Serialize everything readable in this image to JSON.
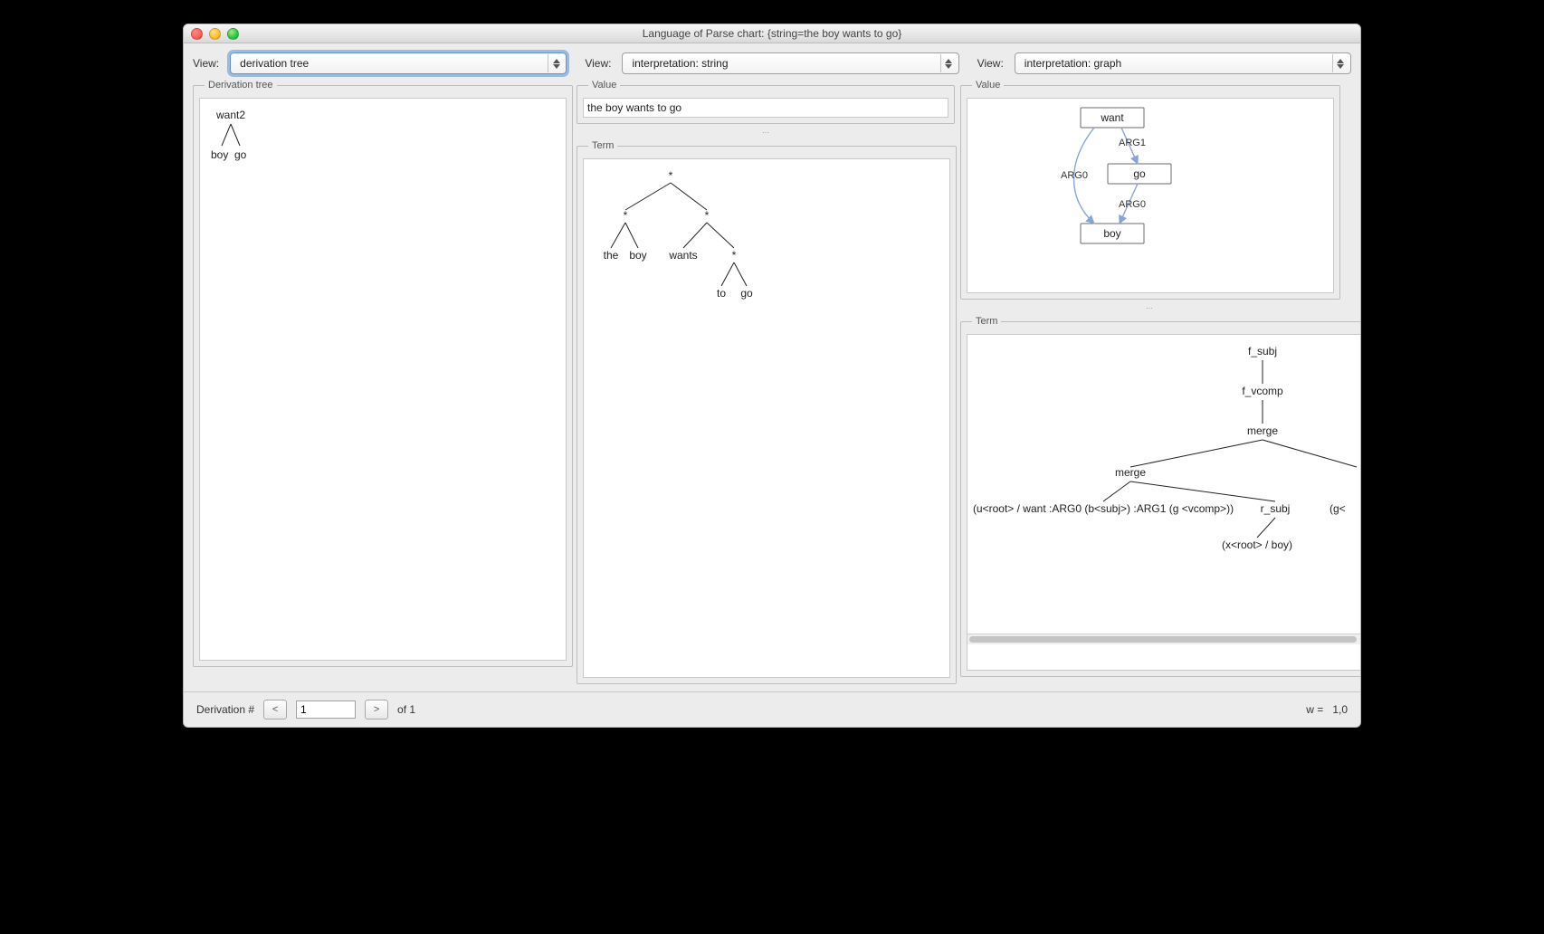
{
  "window": {
    "title": "Language of Parse chart: {string=the boy wants to go}"
  },
  "toolbar": {
    "view_label": "View:",
    "dropdowns": {
      "col1": "derivation tree",
      "col2": "interpretation: string",
      "col3": "interpretation: graph"
    }
  },
  "col1": {
    "legend": "Derivation tree",
    "tree": {
      "root": "want2",
      "leaves": [
        "boy",
        "go"
      ]
    }
  },
  "col2": {
    "value_legend": "Value",
    "value_text": "the boy wants to go",
    "term_legend": "Term",
    "term_tree": {
      "nodes": [
        "*",
        "*",
        "*",
        "*",
        "the",
        "boy",
        "wants",
        "to",
        "go"
      ]
    }
  },
  "col3": {
    "value_legend": "Value",
    "term_legend": "Term",
    "graph": {
      "nodes": [
        "want",
        "go",
        "boy"
      ],
      "edges": [
        {
          "from": "want",
          "to": "go",
          "label": "ARG1"
        },
        {
          "from": "want",
          "to": "boy",
          "label": "ARG0"
        },
        {
          "from": "go",
          "to": "boy",
          "label": "ARG0"
        }
      ]
    },
    "term_tree": {
      "labels": {
        "n0": "f_subj",
        "n1": "f_vcomp",
        "n2": "merge",
        "n3": "merge",
        "n4": "(u<root> / want  :ARG0 (b<subj>)  :ARG1 (g <vcomp>))",
        "n5": "r_subj",
        "n6": "(g<",
        "n7": "(x<root> / boy)"
      }
    }
  },
  "footer": {
    "label": "Derivation #",
    "prev": "<",
    "next": ">",
    "current": "1",
    "of_label": "of 1",
    "weight_label": "w =",
    "weight_value": "1,0"
  }
}
